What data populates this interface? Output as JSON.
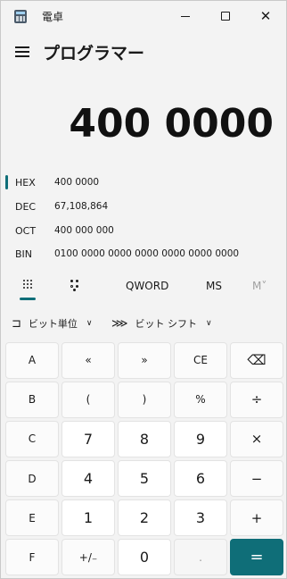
{
  "window": {
    "title": "電卓",
    "controls": {
      "minimize": "minimize",
      "maximize": "maximize",
      "close": "close"
    }
  },
  "header": {
    "mode_title": "プログラマー",
    "display_value": "400 0000"
  },
  "radix": [
    {
      "name": "HEX",
      "value": "400 0000"
    },
    {
      "name": "DEC",
      "value": "67,108,864"
    },
    {
      "name": "OCT",
      "value": "400 000 000"
    },
    {
      "name": "BIN",
      "value": "0100 0000 0000 0000 0000 0000 0000"
    }
  ],
  "tabs": {
    "word_size": "QWORD",
    "ms": "MS",
    "mv": "M˅"
  },
  "bitwise": {
    "bitwise_label": "ビット単位",
    "bitshift_label": "ビット シフト"
  },
  "keys": [
    [
      "A",
      "«",
      "»",
      "CE",
      "⌫"
    ],
    [
      "B",
      "(",
      ")",
      "%",
      "÷"
    ],
    [
      "C",
      "7",
      "8",
      "9",
      "×"
    ],
    [
      "D",
      "4",
      "5",
      "6",
      "−"
    ],
    [
      "E",
      "1",
      "2",
      "3",
      "+"
    ],
    [
      "F",
      "+/₋",
      "0",
      ".",
      "="
    ]
  ],
  "colors": {
    "accent": "#0f6e78",
    "background": "#f3f3f3"
  }
}
